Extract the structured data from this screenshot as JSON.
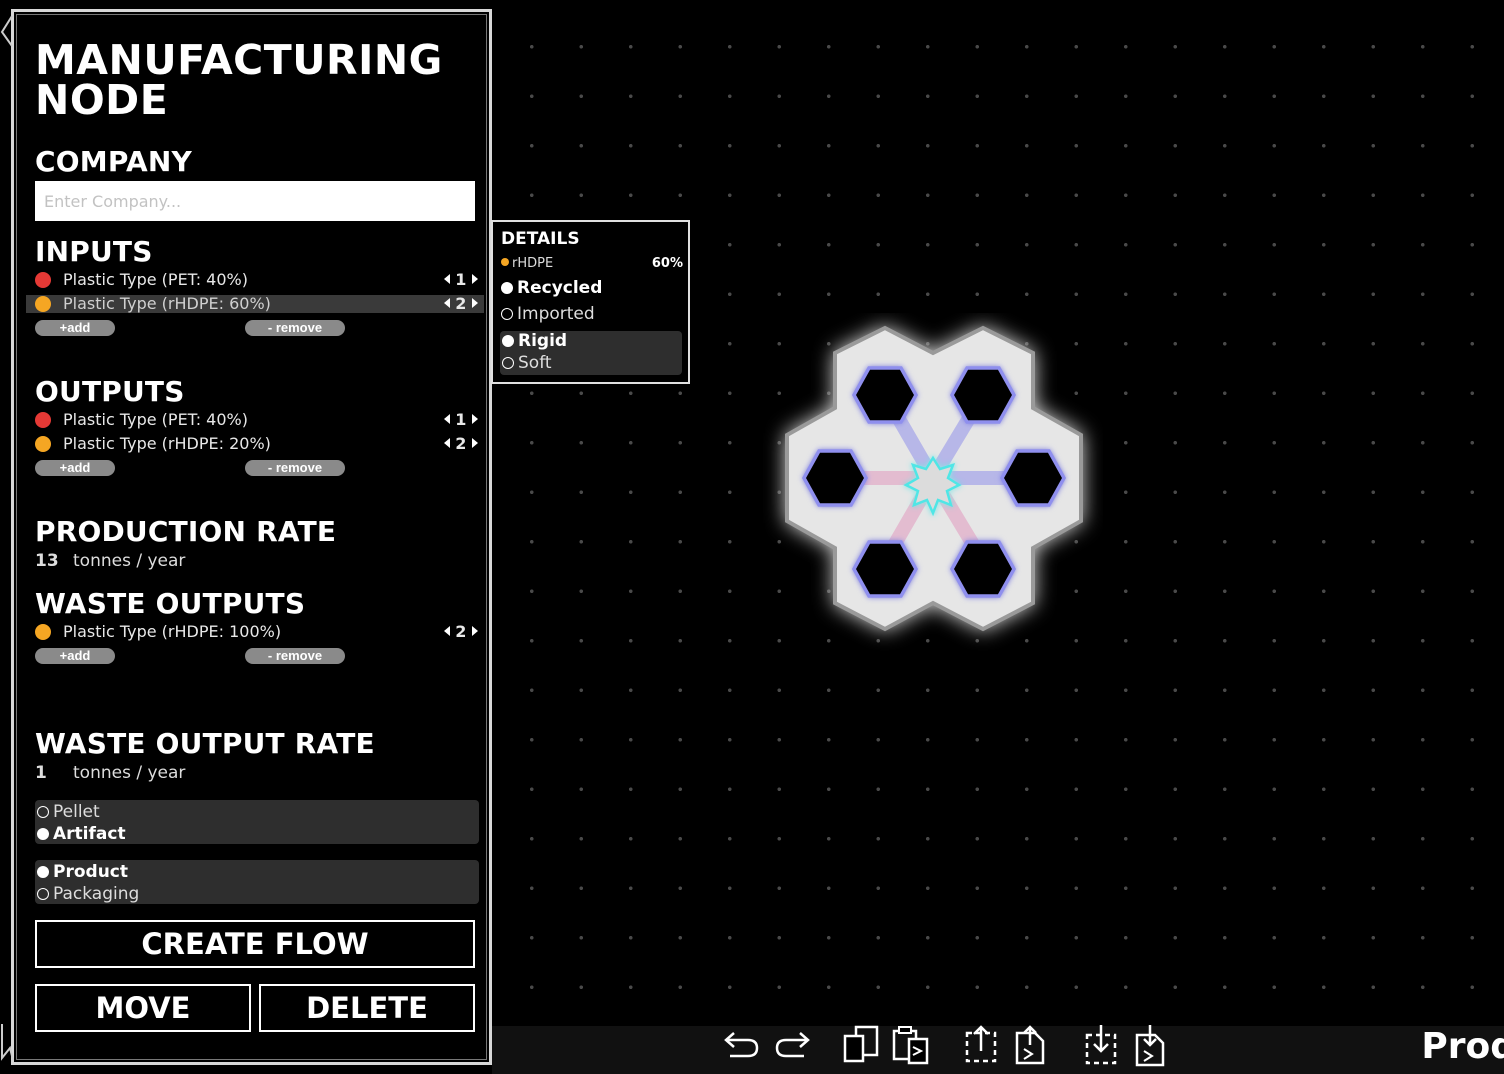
{
  "panel": {
    "title_line1": "MANUFACTURING",
    "title_line2": "NODE",
    "company": {
      "heading": "COMPANY",
      "placeholder": "Enter Company...",
      "value": ""
    },
    "inputs": {
      "heading": "INPUTS",
      "items": [
        {
          "label": "Plastic Type (PET: 40%)",
          "color": "#e53935",
          "step": "1",
          "selected": false
        },
        {
          "label": "Plastic Type (rHDPE: 60%)",
          "color": "#f5a623",
          "step": "2",
          "selected": true
        }
      ],
      "add_label": "+add",
      "remove_label": "- remove"
    },
    "outputs": {
      "heading": "OUTPUTS",
      "items": [
        {
          "label": "Plastic Type (PET: 40%)",
          "color": "#e53935",
          "step": "1"
        },
        {
          "label": "Plastic Type (rHDPE: 20%)",
          "color": "#f5a623",
          "step": "2"
        }
      ],
      "add_label": "+add",
      "remove_label": "- remove"
    },
    "production_rate": {
      "heading": "PRODUCTION RATE",
      "value": "13",
      "unit": "tonnes / year"
    },
    "waste_outputs": {
      "heading": "WASTE OUTPUTS",
      "items": [
        {
          "label": "Plastic Type (rHDPE: 100%)",
          "color": "#f5a623",
          "step": "2"
        }
      ],
      "add_label": "+add",
      "remove_label": "- remove"
    },
    "waste_output_rate": {
      "heading": "WASTE OUTPUT RATE",
      "value": "1",
      "unit": "tonnes / year"
    },
    "form_options": [
      {
        "label": "Pellet",
        "checked": false
      },
      {
        "label": "Artifact",
        "checked": true
      }
    ],
    "use_options": [
      {
        "label": "Product",
        "checked": true
      },
      {
        "label": "Packaging",
        "checked": false
      }
    ],
    "create_flow_label": "CREATE FLOW",
    "move_label": "MOVE",
    "delete_label": "DELETE"
  },
  "details": {
    "title": "DETAILS",
    "material": "rHDPE",
    "material_color": "#f5a623",
    "percent": "60%",
    "source_options": [
      {
        "label": "Recycled",
        "checked": true
      },
      {
        "label": "Imported",
        "checked": false
      }
    ],
    "rigidity_options": [
      {
        "label": "Rigid",
        "checked": true
      },
      {
        "label": "Soft",
        "checked": false
      }
    ]
  },
  "toolbar": {
    "icons": [
      "undo-icon",
      "redo-icon",
      "copy-icon",
      "paste-icon",
      "upload-icon",
      "export-icon",
      "download-icon",
      "import-icon"
    ],
    "status_text": "Prod"
  }
}
